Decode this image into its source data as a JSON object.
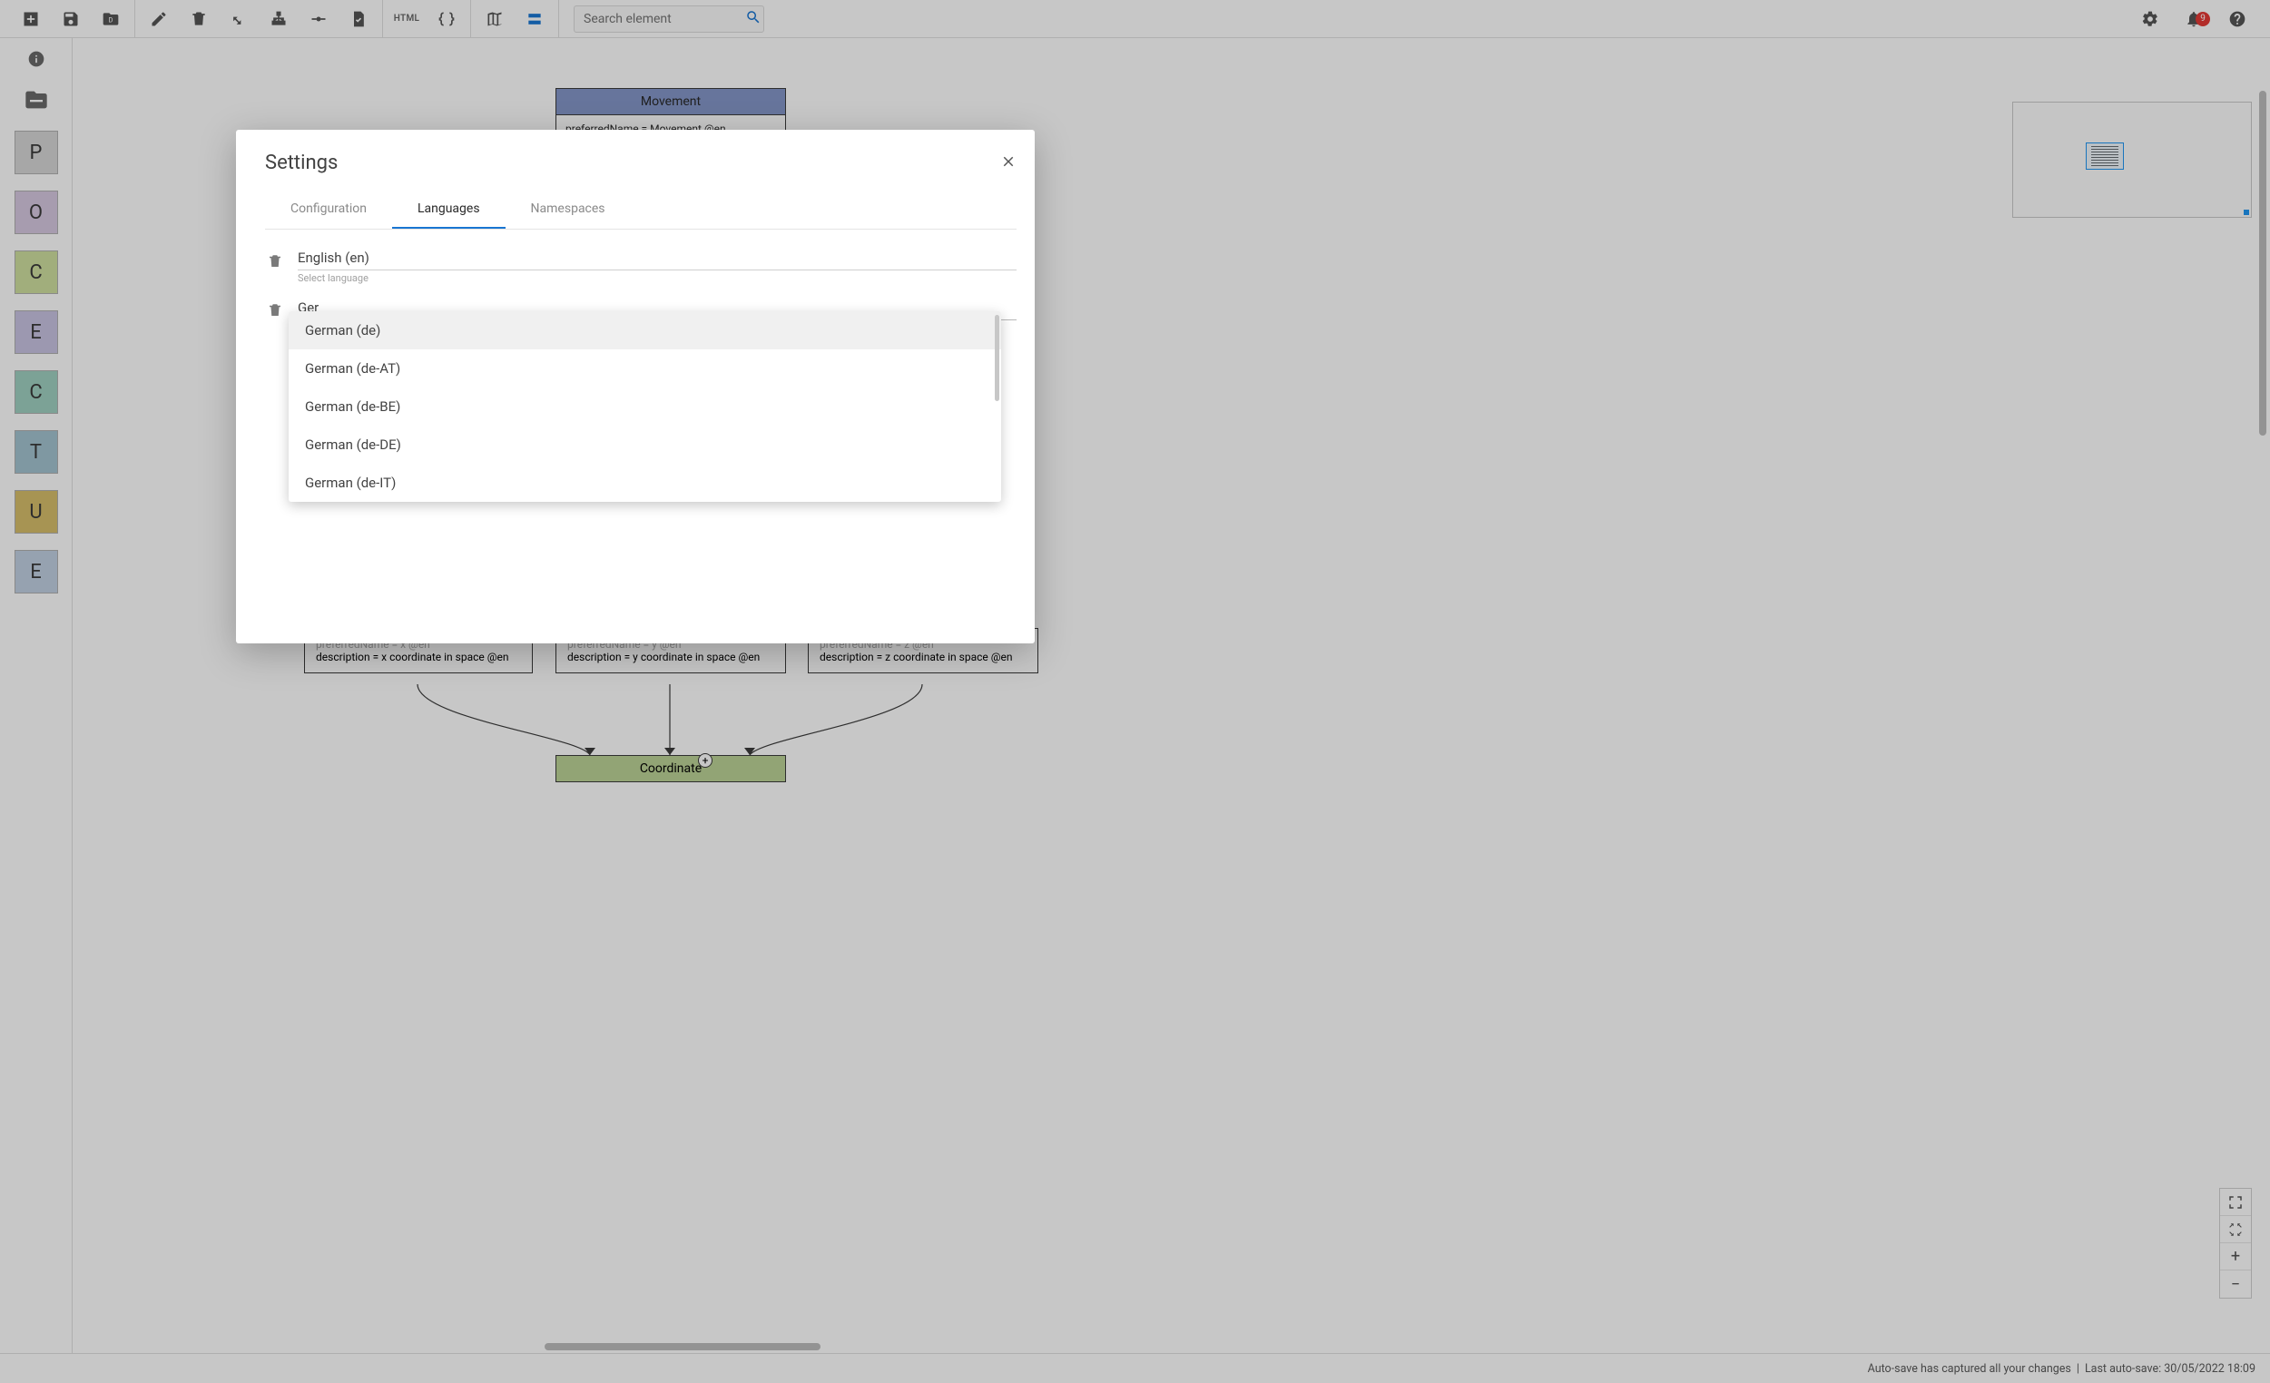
{
  "toolbar": {
    "search_placeholder": "Search element",
    "notification_count": "9"
  },
  "palette": [
    {
      "letter": "P",
      "bg": "#d6d6d6"
    },
    {
      "letter": "O",
      "bg": "#d6c8e0"
    },
    {
      "letter": "C",
      "bg": "#cfdf9f"
    },
    {
      "letter": "E",
      "bg": "#c8c3e2"
    },
    {
      "letter": "C",
      "bg": "#9fd0c0"
    },
    {
      "letter": "T",
      "bg": "#a3c3d0"
    },
    {
      "letter": "U",
      "bg": "#d7be6b"
    },
    {
      "letter": "E",
      "bg": "#c0d0e2"
    }
  ],
  "canvas": {
    "movement": {
      "title": "Movement",
      "body": "preferredName = Movement @en"
    },
    "x": {
      "l1": "preferredName = x @en",
      "l2": "description = x coordinate in space @en"
    },
    "y": {
      "l1": "preferredName = y @en",
      "l2": "description = y coordinate in space @en"
    },
    "z": {
      "l1": "preferredName = z @en",
      "l2": "description = z coordinate in space @en"
    },
    "coord_title": "Coordinate",
    "plus": "+"
  },
  "dialog": {
    "title": "Settings",
    "tabs": {
      "configuration": "Configuration",
      "languages": "Languages",
      "namespaces": "Namespaces"
    },
    "lang1": "English (en)",
    "hint": "Select language",
    "lang2_input": "Ger",
    "dropdown": [
      "German (de)",
      "German (de-AT)",
      "German (de-BE)",
      "German (de-DE)",
      "German (de-IT)"
    ]
  },
  "status": {
    "autosave_msg": "Auto-save has captured all your changes",
    "last_autosave": "Last auto-save: 30/05/2022 18:09"
  }
}
